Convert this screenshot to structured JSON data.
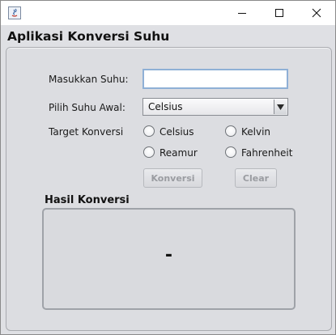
{
  "window": {
    "controls": {
      "minimize_icon": "minimize-icon",
      "maximize_icon": "maximize-icon",
      "close_icon": "close-icon"
    }
  },
  "app": {
    "title": "Aplikasi Konversi Suhu"
  },
  "form": {
    "input_label": "Masukkan Suhu:",
    "input_value": "",
    "select_label": "Pilih Suhu Awal:",
    "select_value": "Celsius",
    "target_label": "Target Konversi",
    "targets": [
      {
        "label": "Celsius",
        "selected": false
      },
      {
        "label": "Kelvin",
        "selected": false
      },
      {
        "label": "Reamur",
        "selected": false
      },
      {
        "label": "Fahrenheit",
        "selected": false
      }
    ],
    "convert_label": "Konversi",
    "clear_label": "Clear"
  },
  "result": {
    "title": "Hasil Konversi",
    "value": "-"
  },
  "colors": {
    "panel_bg": "#dcdde1",
    "input_focus_border": "#8fb0d6",
    "disabled_text": "#9a9ca1"
  }
}
